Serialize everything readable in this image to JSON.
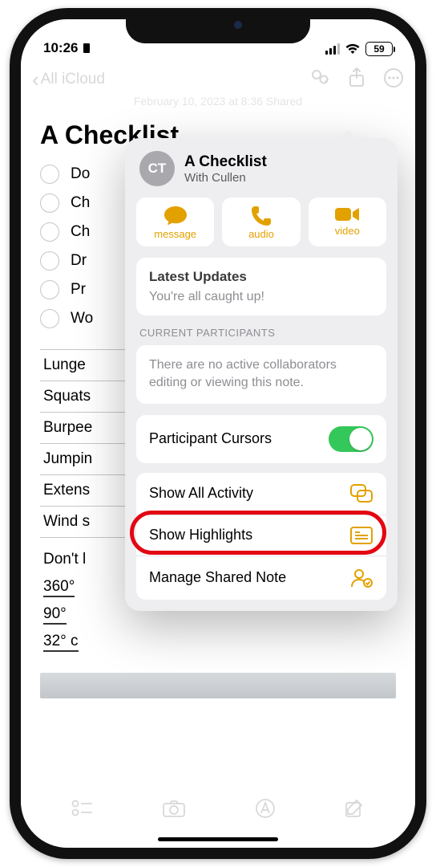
{
  "status": {
    "time": "10:26",
    "battery": "59"
  },
  "nav": {
    "back_label": "All iCloud"
  },
  "note": {
    "meta": "February 10, 2023 at 8:36   Shared",
    "title": "A Checklist",
    "check_items": [
      "Do",
      "Ch",
      "Ch",
      "Dr",
      "Pr",
      "Wo"
    ],
    "table_rows": [
      "Lunge",
      "Squats",
      "Burpee",
      "Jumpin",
      "Extens",
      "Wind s"
    ],
    "plain_lines": [
      "Don't l",
      "360°",
      "90°",
      "32° c"
    ]
  },
  "popover": {
    "avatar_initials": "CT",
    "title": "A Checklist",
    "subtitle": "With Cullen",
    "contacts": {
      "message": "message",
      "audio": "audio",
      "video": "video"
    },
    "updates": {
      "heading": "Latest Updates",
      "body": "You're all caught up!"
    },
    "participants_label": "CURRENT PARTICIPANTS",
    "participants_body": "There are no active collaborators editing or viewing this note.",
    "rows": {
      "cursors": "Participant Cursors",
      "activity": "Show All Activity",
      "highlights": "Show Highlights",
      "manage": "Manage Shared Note"
    }
  }
}
